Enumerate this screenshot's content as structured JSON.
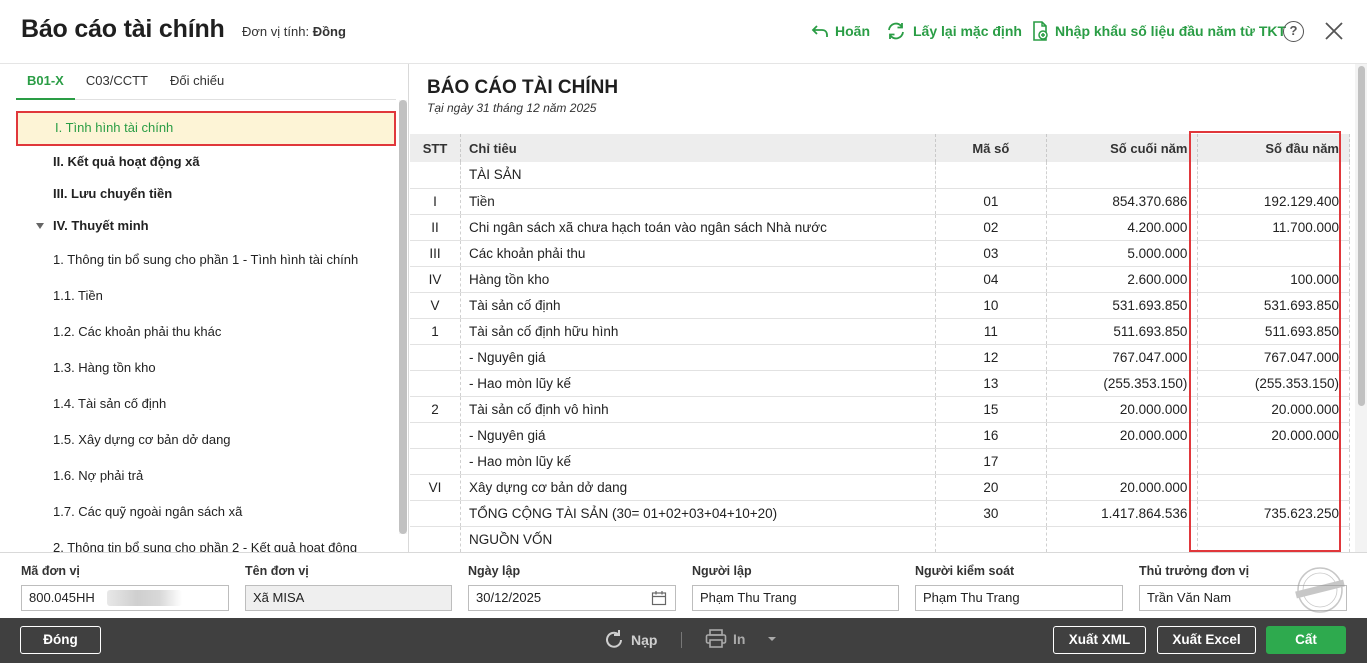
{
  "header": {
    "title": "Báo cáo tài chính",
    "unit_label": "Đơn vị tính:",
    "unit_value": "Đồng",
    "undo_label": "Hoãn",
    "reset_label": "Lấy lại mặc định",
    "import_label": "Nhập khẩu số liệu đầu năm từ TKT",
    "help_glyph": "?"
  },
  "sidebar": {
    "tabs": [
      {
        "label": "B01-X",
        "active": true
      },
      {
        "label": "C03/CCTT",
        "active": false
      },
      {
        "label": "Đối chiếu",
        "active": false
      }
    ],
    "items": [
      {
        "label": "I. Tình hình tài chính"
      },
      {
        "label": "II. Kết quả hoạt động xã"
      },
      {
        "label": "III. Lưu chuyển tiền"
      },
      {
        "label": "IV. Thuyết minh"
      },
      {
        "label": "1. Thông tin bổ sung cho phần 1 - Tình hình tài chính"
      },
      {
        "label": "1.1. Tiền"
      },
      {
        "label": "1.2. Các khoản phải thu khác"
      },
      {
        "label": "1.3. Hàng tồn kho"
      },
      {
        "label": "1.4. Tài sản cố định"
      },
      {
        "label": "1.5. Xây dựng cơ bản dở dang"
      },
      {
        "label": "1.6. Nợ phải trả"
      },
      {
        "label": "1.7. Các quỹ ngoài ngân sách xã"
      },
      {
        "label": "2. Thông tin bổ sung cho phần 2 - Kết quả hoạt động"
      }
    ]
  },
  "report": {
    "title": "BÁO CÁO TÀI CHÍNH",
    "date": "Tại ngày 31 tháng 12 năm 2025",
    "columns": [
      "STT",
      "Chỉ tiêu",
      "Mã số",
      "Số cuối năm",
      "Số đầu năm"
    ],
    "rows": [
      [
        "",
        "TÀI SẢN",
        "",
        "",
        ""
      ],
      [
        "I",
        "Tiền",
        "01",
        "854.370.686",
        "192.129.400"
      ],
      [
        "II",
        "Chi ngân sách xã chưa hạch toán vào ngân sách Nhà nước",
        "02",
        "4.200.000",
        "11.700.000"
      ],
      [
        "III",
        "Các khoản phải thu",
        "03",
        "5.000.000",
        ""
      ],
      [
        "IV",
        "Hàng tồn kho",
        "04",
        "2.600.000",
        "100.000"
      ],
      [
        "V",
        "Tài sản cố định",
        "10",
        "531.693.850",
        "531.693.850"
      ],
      [
        "1",
        "Tài sản cố định hữu hình",
        "11",
        "511.693.850",
        "511.693.850"
      ],
      [
        "",
        "- Nguyên giá",
        "12",
        "767.047.000",
        "767.047.000"
      ],
      [
        "",
        "- Hao mòn lũy kế",
        "13",
        "(255.353.150)",
        "(255.353.150)"
      ],
      [
        "2",
        "Tài sản cố định vô hình",
        "15",
        "20.000.000",
        "20.000.000"
      ],
      [
        "",
        "- Nguyên giá",
        "16",
        "20.000.000",
        "20.000.000"
      ],
      [
        "",
        "- Hao mòn lũy kế",
        "17",
        "",
        ""
      ],
      [
        "VI",
        "Xây dựng cơ bản dở dang",
        "20",
        "20.000.000",
        ""
      ],
      [
        "",
        "TỔNG CỘNG TÀI SẢN (30= 01+02+03+04+10+20)",
        "30",
        "1.417.864.536",
        "735.623.250"
      ],
      [
        "",
        "NGUỒN VỐN",
        "",
        "",
        ""
      ]
    ]
  },
  "form": {
    "unit_code_label": "Mã đơn vị",
    "unit_code_value": "800.045HH",
    "unit_name_label": "Tên đơn vị",
    "unit_name_value": "Xã MISA",
    "date_label": "Ngày lập",
    "date_value": "30/12/2025",
    "preparer_label": "Người lập",
    "preparer_value": "Phạm Thu Trang",
    "controller_label": "Người kiểm soát",
    "controller_value": "Phạm Thu Trang",
    "head_label": "Thủ trưởng đơn vị",
    "head_value": "Trần Văn Nam"
  },
  "footer": {
    "close_label": "Đóng",
    "reload_label": "Nạp",
    "print_label": "In",
    "export_xml_label": "Xuất XML",
    "export_excel_label": "Xuất Excel",
    "save_label": "Cất"
  },
  "colors": {
    "accent": "#2a9d45",
    "highlight_border": "#e0373b",
    "footer_bg": "#404040",
    "save_bg": "#2eaa4e"
  }
}
